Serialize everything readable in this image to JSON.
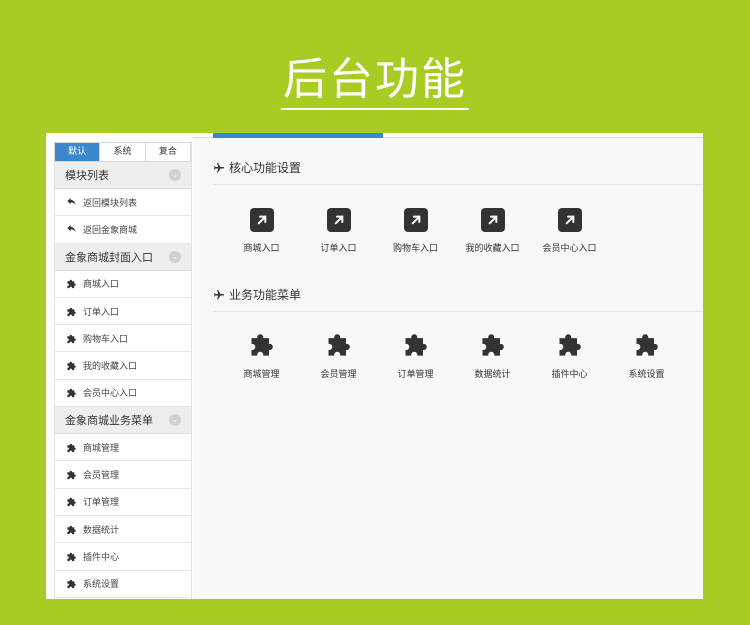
{
  "hero": {
    "title": "后台功能"
  },
  "sidebar": {
    "tabs": [
      {
        "label": "默认",
        "active": true
      },
      {
        "label": "系统",
        "active": false
      },
      {
        "label": "复合",
        "active": false
      }
    ],
    "groups": [
      {
        "title": "模块列表",
        "items": [
          {
            "label": "返回模块列表",
            "icon": "undo-icon"
          },
          {
            "label": "返回金象商城",
            "icon": "undo-icon"
          }
        ]
      },
      {
        "title": "金象商城封面入口",
        "items": [
          {
            "label": "商城入口",
            "icon": "puzzle-icon"
          },
          {
            "label": "订单入口",
            "icon": "puzzle-icon"
          },
          {
            "label": "购物车入口",
            "icon": "puzzle-icon"
          },
          {
            "label": "我的收藏入口",
            "icon": "puzzle-icon"
          },
          {
            "label": "会员中心入口",
            "icon": "puzzle-icon"
          }
        ]
      },
      {
        "title": "金象商城业务菜单",
        "items": [
          {
            "label": "商城管理",
            "icon": "puzzle-icon"
          },
          {
            "label": "会员管理",
            "icon": "puzzle-icon"
          },
          {
            "label": "订单管理",
            "icon": "puzzle-icon"
          },
          {
            "label": "数据统计",
            "icon": "puzzle-icon"
          },
          {
            "label": "插件中心",
            "icon": "puzzle-icon"
          },
          {
            "label": "系统设置",
            "icon": "puzzle-icon"
          }
        ]
      }
    ]
  },
  "main": {
    "core": {
      "title": "核心功能设置",
      "icon": "plane-icon",
      "tiles": [
        {
          "label": "商城入口",
          "icon": "external-link-icon"
        },
        {
          "label": "订单入口",
          "icon": "external-link-icon"
        },
        {
          "label": "购物车入口",
          "icon": "external-link-icon"
        },
        {
          "label": "我的收藏入口",
          "icon": "external-link-icon"
        },
        {
          "label": "会员中心入口",
          "icon": "external-link-icon"
        }
      ]
    },
    "business": {
      "title": "业务功能菜单",
      "icon": "plane-icon",
      "tiles": [
        {
          "label": "商城管理",
          "icon": "puzzle-icon"
        },
        {
          "label": "会员管理",
          "icon": "puzzle-icon"
        },
        {
          "label": "订单管理",
          "icon": "puzzle-icon"
        },
        {
          "label": "数据统计",
          "icon": "puzzle-icon"
        },
        {
          "label": "插件中心",
          "icon": "puzzle-icon"
        },
        {
          "label": "系统设置",
          "icon": "puzzle-icon"
        }
      ]
    }
  },
  "colors": {
    "background": "#a8cc24",
    "accent": "#3b88cf",
    "icon": "#333333"
  }
}
